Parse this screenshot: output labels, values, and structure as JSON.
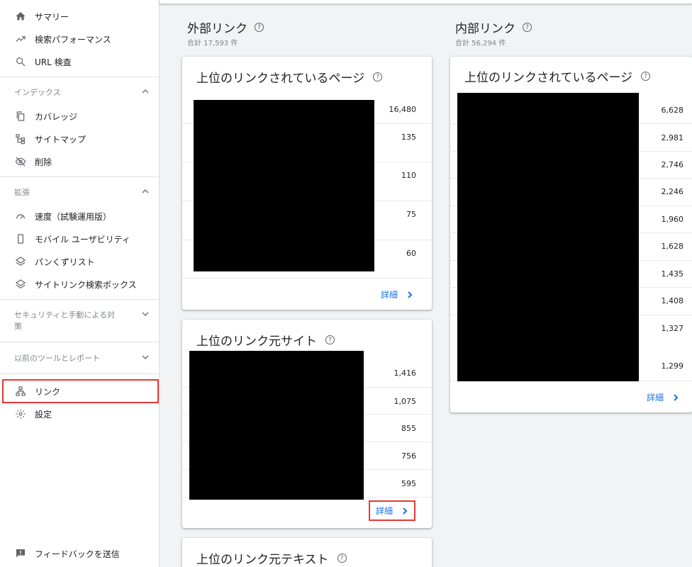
{
  "sidebar": {
    "items_top": [
      {
        "label": "サマリー",
        "icon": "home-icon"
      },
      {
        "label": "検索パフォーマンス",
        "icon": "trending-up-icon"
      },
      {
        "label": "URL 検査",
        "icon": "search-icon"
      }
    ],
    "section_index": {
      "label": "インデックス"
    },
    "items_index": [
      {
        "label": "カバレッジ",
        "icon": "copy-icon"
      },
      {
        "label": "サイトマップ",
        "icon": "sitemap-icon"
      },
      {
        "label": "削除",
        "icon": "eye-off-icon"
      }
    ],
    "section_enhance": {
      "label": "拡張"
    },
    "items_enhance": [
      {
        "label": "速度（試験運用版）",
        "icon": "speed-icon"
      },
      {
        "label": "モバイル ユーザビリティ",
        "icon": "phone-icon"
      },
      {
        "label": "パンくずリスト",
        "icon": "layers-icon"
      },
      {
        "label": "サイトリンク検索ボックス",
        "icon": "layers-icon"
      }
    ],
    "section_security": {
      "label": "セキュリティと手動による対策"
    },
    "section_legacy": {
      "label": "以前のツールとレポート"
    },
    "item_links": {
      "label": "リンク",
      "icon": "links-icon"
    },
    "item_settings": {
      "label": "設定",
      "icon": "gear-icon"
    },
    "feedback": {
      "label": "フィードバックを送信",
      "icon": "feedback-icon"
    }
  },
  "external": {
    "title": "外部リンク",
    "total": "合計 17,593 件",
    "top_pages": {
      "title": "上位のリンクされているページ",
      "values": [
        "16,480",
        "135",
        "110",
        "75",
        "60"
      ],
      "detail": "詳細"
    },
    "top_sites": {
      "title": "上位のリンク元サイト",
      "values": [
        "1,416",
        "1,075",
        "855",
        "756",
        "595"
      ],
      "detail": "詳細"
    },
    "top_text": {
      "title": "上位のリンク元テキスト"
    }
  },
  "internal": {
    "title": "内部リンク",
    "total": "合計 56,294 件",
    "top_pages": {
      "title": "上位のリンクされているページ",
      "values": [
        "6,628",
        "2,981",
        "2,746",
        "2,246",
        "1,960",
        "1,628",
        "1,435",
        "1,408",
        "1,327",
        "1,299"
      ],
      "detail": "詳細"
    }
  },
  "help_glyph": "?"
}
